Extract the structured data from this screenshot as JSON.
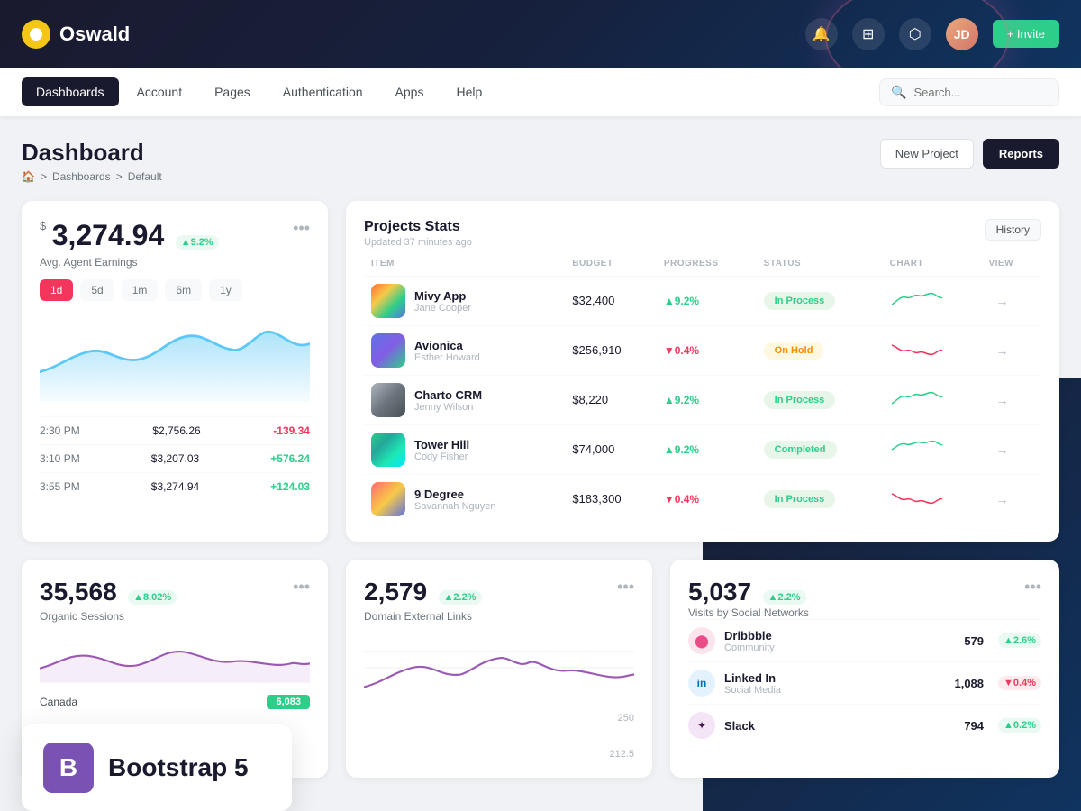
{
  "topbar": {
    "logo_text": "Oswald",
    "invite_label": "+ Invite",
    "invite_color": "#2dce89"
  },
  "mainnav": {
    "items": [
      {
        "label": "Dashboards",
        "active": true
      },
      {
        "label": "Account",
        "active": false
      },
      {
        "label": "Pages",
        "active": false
      },
      {
        "label": "Authentication",
        "active": false
      },
      {
        "label": "Apps",
        "active": false
      },
      {
        "label": "Help",
        "active": false
      }
    ],
    "search_placeholder": "Search..."
  },
  "page": {
    "title": "Dashboard",
    "breadcrumb": [
      "🏠",
      "Dashboards",
      "Default"
    ],
    "btn_new_project": "New Project",
    "btn_reports": "Reports"
  },
  "earnings_card": {
    "currency": "$",
    "amount": "3,274.94",
    "badge": "▲9.2%",
    "label": "Avg. Agent Earnings",
    "filters": [
      "1d",
      "5d",
      "1m",
      "6m",
      "1y"
    ],
    "active_filter": "1d",
    "stats": [
      {
        "time": "2:30 PM",
        "amount": "$2,756.26",
        "change": "-139.34",
        "positive": false
      },
      {
        "time": "3:10 PM",
        "amount": "$3,207.03",
        "change": "+576.24",
        "positive": true
      },
      {
        "time": "3:55 PM",
        "amount": "$3,274.94",
        "change": "+124.03",
        "positive": true
      }
    ]
  },
  "projects": {
    "title": "Projects Stats",
    "subtitle": "Updated 37 minutes ago",
    "history_btn": "History",
    "columns": [
      "ITEM",
      "BUDGET",
      "PROGRESS",
      "STATUS",
      "CHART",
      "VIEW"
    ],
    "rows": [
      {
        "name": "Mivy App",
        "person": "Jane Cooper",
        "budget": "$32,400",
        "progress": "▲9.2%",
        "progress_up": true,
        "status": "In Process",
        "status_type": "in-process",
        "av_class": "av-mivy"
      },
      {
        "name": "Avionica",
        "person": "Esther Howard",
        "budget": "$256,910",
        "progress": "▼0.4%",
        "progress_up": false,
        "status": "On Hold",
        "status_type": "on-hold",
        "av_class": "av-avionica"
      },
      {
        "name": "Charto CRM",
        "person": "Jenny Wilson",
        "budget": "$8,220",
        "progress": "▲9.2%",
        "progress_up": true,
        "status": "In Process",
        "status_type": "in-process",
        "av_class": "av-charto"
      },
      {
        "name": "Tower Hill",
        "person": "Cody Fisher",
        "budget": "$74,000",
        "progress": "▲9.2%",
        "progress_up": true,
        "status": "Completed",
        "status_type": "completed",
        "av_class": "av-tower"
      },
      {
        "name": "9 Degree",
        "person": "Savannah Nguyen",
        "budget": "$183,300",
        "progress": "▼0.4%",
        "progress_up": false,
        "status": "In Process",
        "status_type": "in-process",
        "av_class": "av-9degree"
      }
    ]
  },
  "sessions": {
    "amount": "35,568",
    "badge": "▲8.02%",
    "label": "Organic Sessions",
    "country": "Canada",
    "country_value": "6,083"
  },
  "external_links": {
    "amount": "2,579",
    "badge": "▲2.2%",
    "label": "Domain External Links"
  },
  "social": {
    "amount": "5,037",
    "badge": "▲2.2%",
    "label": "Visits by Social Networks",
    "items": [
      {
        "name": "Dribbble",
        "type": "Community",
        "count": "579",
        "change": "▲2.6%",
        "up": true,
        "color": "#ea4c89"
      },
      {
        "name": "Linked In",
        "type": "Social Media",
        "count": "1,088",
        "change": "▼0.4%",
        "up": false,
        "color": "#0077b5"
      },
      {
        "name": "Slack",
        "type": "",
        "count": "794",
        "change": "▲0.2%",
        "up": true,
        "color": "#4a154b"
      }
    ]
  },
  "bootstrap": {
    "logo_letter": "B",
    "text": "Bootstrap 5"
  }
}
